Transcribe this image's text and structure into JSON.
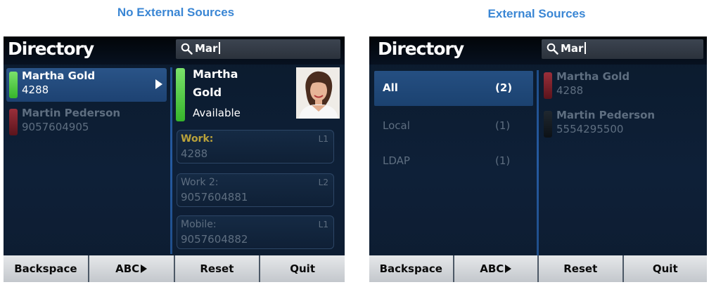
{
  "captions": {
    "left": "No External Sources",
    "right": "External Sources"
  },
  "colors": {
    "caption": "#3a86d4",
    "available": "#36b52b",
    "busy": "#5a141c",
    "selection": "#1d4272"
  },
  "screen_left": {
    "title": "Directory",
    "search": {
      "icon": "search-icon",
      "value": "Mar"
    },
    "contacts": [
      {
        "name": "Martha Gold",
        "number": "4288",
        "status": "available",
        "selected": true
      },
      {
        "name": "Martin Pederson",
        "number": "9057604905",
        "status": "busy",
        "selected": false
      }
    ],
    "detail": {
      "first_name": "Martha",
      "last_name": "Gold",
      "presence": "Available",
      "numbers": [
        {
          "label": "Work:",
          "line": "L1",
          "value": "4288"
        },
        {
          "label": "Work 2:",
          "line": "L2",
          "value": "9057604881"
        },
        {
          "label": "Mobile:",
          "line": "L1",
          "value": "9057604882"
        }
      ]
    },
    "softkeys": [
      "Backspace",
      "ABC",
      "Reset",
      "Quit"
    ]
  },
  "screen_right": {
    "title": "Directory",
    "search": {
      "icon": "search-icon",
      "value": "Mar"
    },
    "sources": [
      {
        "label": "All",
        "count": "(2)",
        "selected": true
      },
      {
        "label": "Local",
        "count": "(1)",
        "selected": false
      },
      {
        "label": "LDAP",
        "count": "(1)",
        "selected": false
      }
    ],
    "contacts": [
      {
        "name": "Martha Gold",
        "number": "4288",
        "status": "busy"
      },
      {
        "name": "Martin Pederson",
        "number": "5554295500",
        "status": "offline"
      }
    ],
    "softkeys": [
      "Backspace",
      "ABC",
      "Reset",
      "Quit"
    ]
  }
}
